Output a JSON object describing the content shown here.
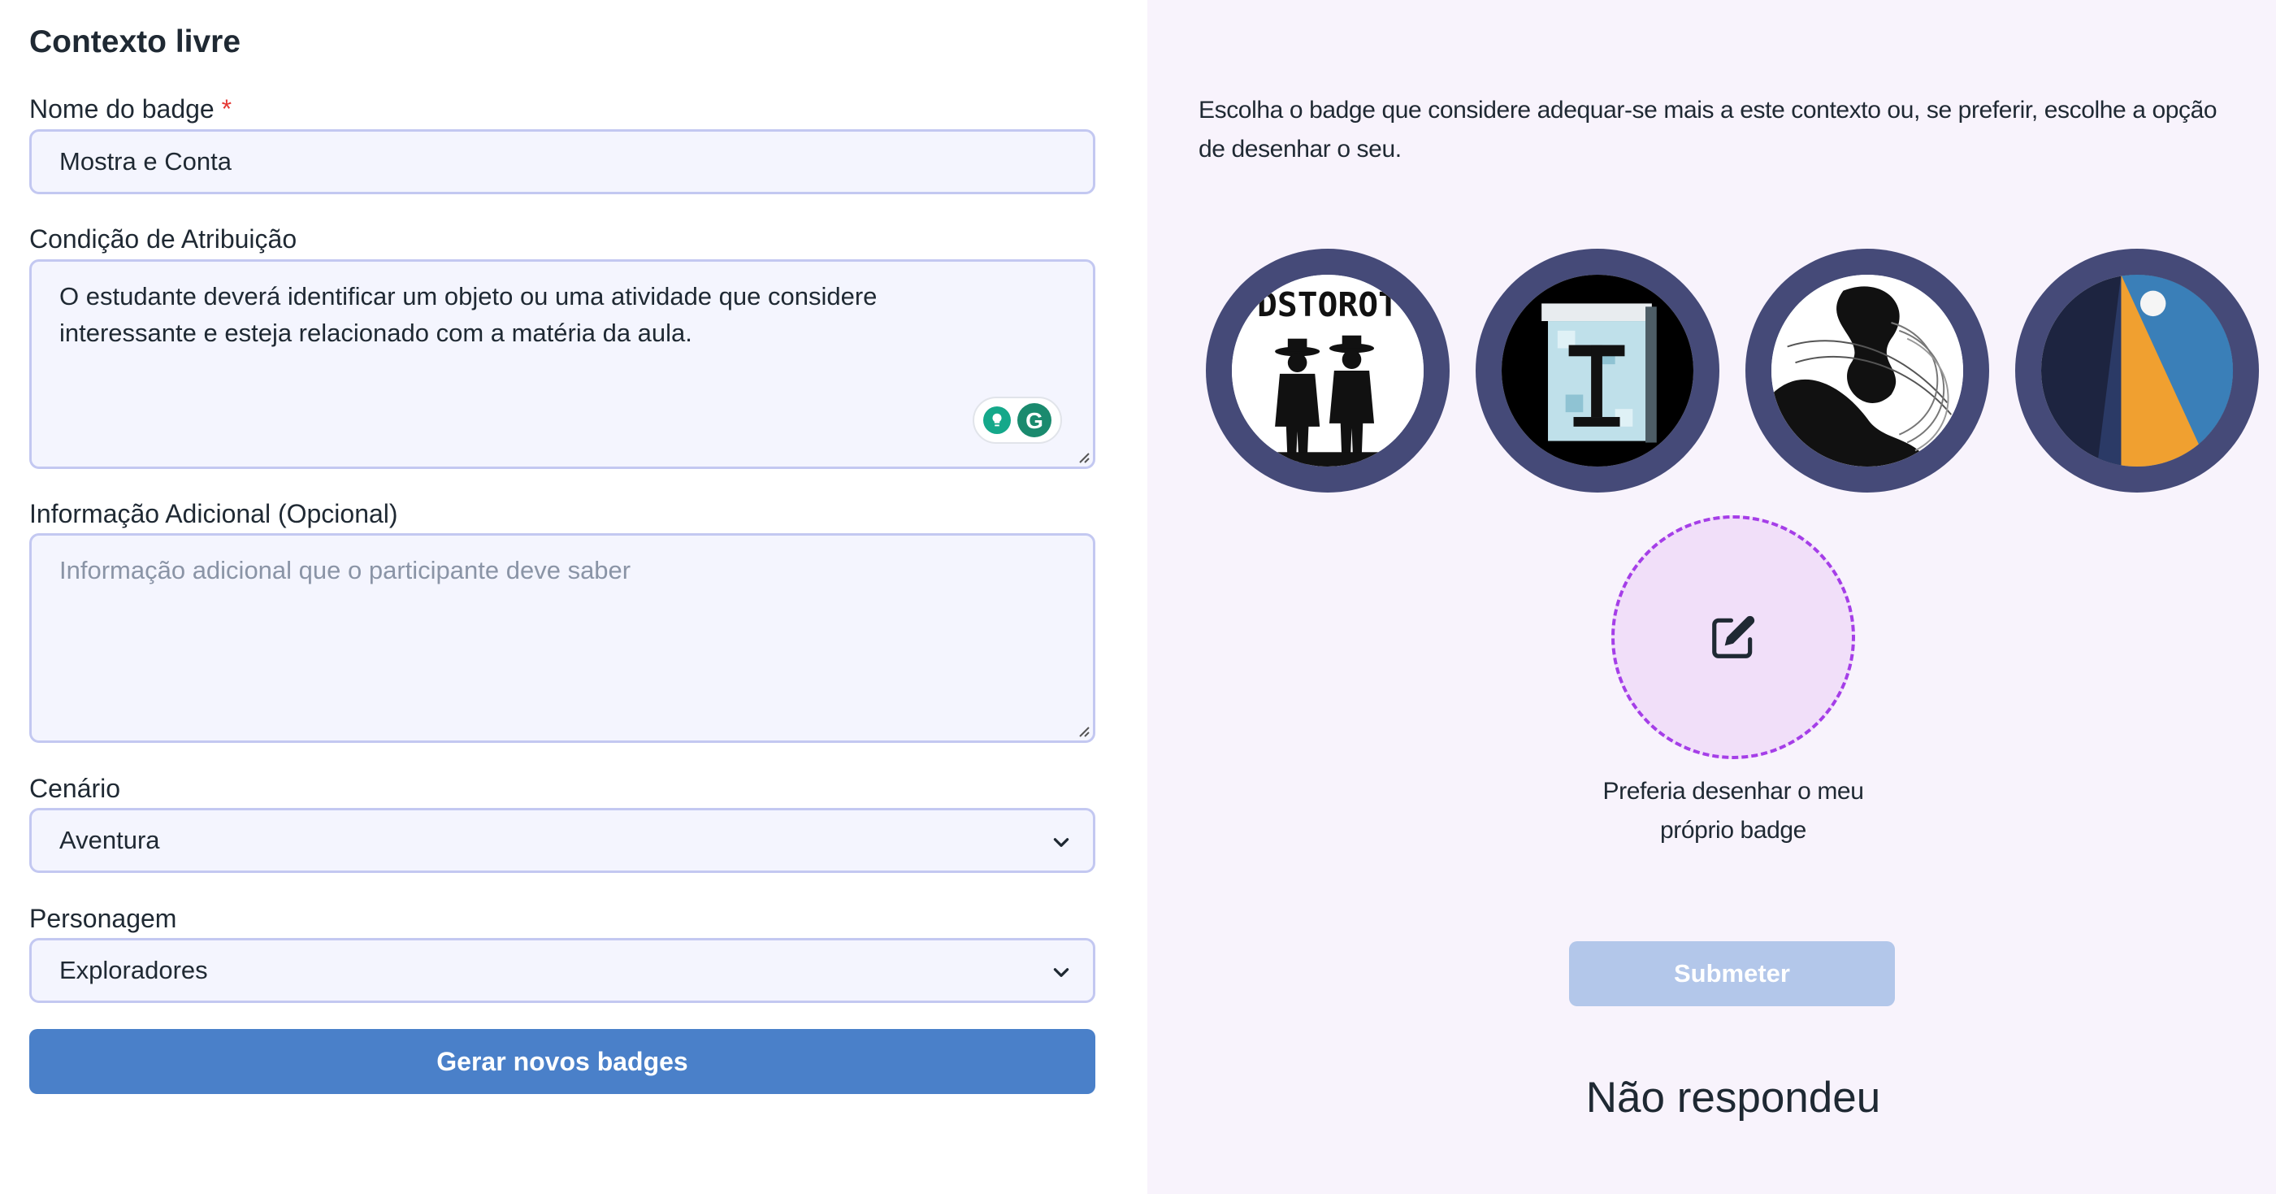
{
  "form": {
    "title": "Contexto livre",
    "badge_name": {
      "label": "Nome do badge",
      "required_mark": "*",
      "value": "Mostra e Conta"
    },
    "condition": {
      "label": "Condição de Atribuição",
      "value": "O estudante deverá identificar um objeto ou uma atividade que considere interessante e esteja relacionado com a matéria da aula."
    },
    "additional_info": {
      "label": "Informação Adicional (Opcional)",
      "placeholder": "Informação adicional que o participante deve saber",
      "value": ""
    },
    "scenario": {
      "label": "Cenário",
      "selected": "Aventura"
    },
    "character": {
      "label": "Personagem",
      "selected": "Exploradores"
    },
    "generate_button": "Gerar novos badges"
  },
  "picker": {
    "intro": "Escolha o badge que considere adequar-se mais a este contexto ou, se preferir, escolhe a opção de desenhar o seu.",
    "badges": [
      {
        "name": "badge-explorers",
        "image_text": "DSTOROT"
      },
      {
        "name": "badge-pixel-letter",
        "image_text": "T"
      },
      {
        "name": "badge-abstract-lines",
        "image_text": ""
      },
      {
        "name": "badge-orange-triangle",
        "image_text": ""
      }
    ],
    "draw_own_label": "Preferia desenhar o meu próprio badge",
    "submit_button": "Submeter",
    "status": "Não respondeu"
  },
  "colors": {
    "primary_button": "#4a80c9",
    "disabled_button": "#b3c7ea",
    "badge_ring": "#454a78",
    "draw_dashed": "#a53ee8",
    "right_panel_bg": "#f8f3fc",
    "required_mark": "#e53935"
  },
  "icons": {
    "edit": "pencil-square-icon",
    "select": "chevron-down-icon",
    "grammarly": "grammarly-icon"
  }
}
